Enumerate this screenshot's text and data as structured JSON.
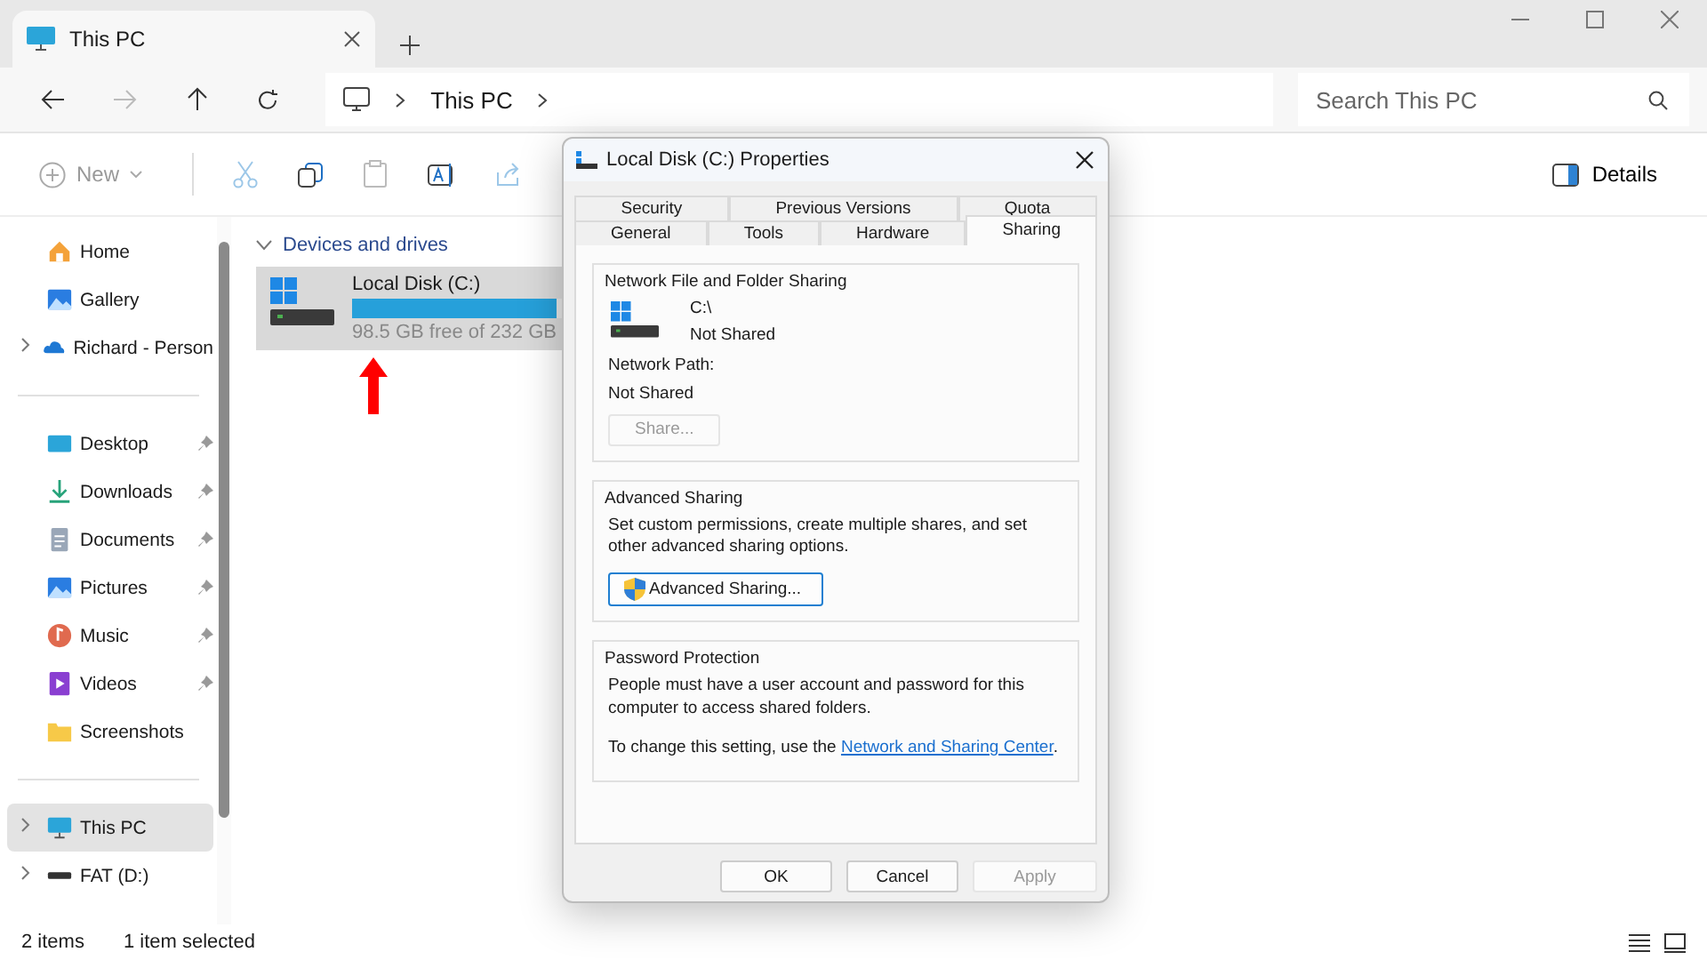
{
  "window": {
    "tab_title": "This PC"
  },
  "nav": {
    "address": [
      "This PC"
    ],
    "search": {
      "placeholder": "Search This PC"
    }
  },
  "command_bar": {
    "new_label": "New",
    "details_label": "Details"
  },
  "sidebar": {
    "groups": [
      [
        {
          "label": "Home",
          "kind": "home",
          "expandable": false,
          "pinned": false,
          "selected": false
        },
        {
          "label": "Gallery",
          "kind": "gallery",
          "expandable": false,
          "pinned": false,
          "selected": false
        },
        {
          "label": "Richard - Person",
          "kind": "cloud",
          "expandable": true,
          "pinned": false,
          "selected": false
        }
      ],
      [
        {
          "label": "Desktop",
          "kind": "desktop",
          "expandable": false,
          "pinned": true,
          "selected": false
        },
        {
          "label": "Downloads",
          "kind": "download",
          "expandable": false,
          "pinned": true,
          "selected": false
        },
        {
          "label": "Documents",
          "kind": "document",
          "expandable": false,
          "pinned": true,
          "selected": false
        },
        {
          "label": "Pictures",
          "kind": "gallery",
          "expandable": false,
          "pinned": true,
          "selected": false
        },
        {
          "label": "Music",
          "kind": "music",
          "expandable": false,
          "pinned": true,
          "selected": false
        },
        {
          "label": "Videos",
          "kind": "video",
          "expandable": false,
          "pinned": true,
          "selected": false
        },
        {
          "label": "Screenshots",
          "kind": "folder",
          "expandable": false,
          "pinned": false,
          "selected": false
        }
      ],
      [
        {
          "label": "This PC",
          "kind": "pc",
          "expandable": true,
          "pinned": false,
          "selected": true
        },
        {
          "label": "FAT (D:)",
          "kind": "drive",
          "expandable": true,
          "pinned": false,
          "selected": false
        }
      ]
    ]
  },
  "content": {
    "section": {
      "title": "Devices and drives",
      "expanded": true
    },
    "drives": [
      {
        "name": "Local Disk (C:)",
        "level": 0.575,
        "free": "98.5 GB free of 232 GB",
        "selected": true
      }
    ]
  },
  "status_bar": {
    "item_count": "2 items",
    "selection": "1 item selected"
  },
  "dialog": {
    "title": "Local Disk (C:) Properties",
    "tab_rows": [
      [
        {
          "label": "Security",
          "selected": false
        },
        {
          "label": "Previous Versions",
          "selected": false
        },
        {
          "label": "Quota",
          "selected": false
        }
      ],
      [
        {
          "label": "General",
          "selected": false
        },
        {
          "label": "Tools",
          "selected": false
        },
        {
          "label": "Hardware",
          "selected": false
        },
        {
          "label": "Sharing",
          "selected": true
        }
      ]
    ],
    "network_sharing": {
      "title": "Network File and Folder Sharing",
      "path": "C:\\",
      "status": "Not Shared",
      "network_path_label": "Network Path:",
      "network_path": "Not Shared",
      "share_button": {
        "label": "Share...",
        "disabled": true
      }
    },
    "advanced_sharing": {
      "title": "Advanced Sharing",
      "description": "Set custom permissions, create multiple shares, and set other advanced sharing options.",
      "button": "Advanced Sharing..."
    },
    "password_protection": {
      "title": "Password Protection",
      "description": "People must have a user account and password for this computer to access shared folders.",
      "link_prefix": "To change this setting, use the",
      "link": "Network and Sharing Center",
      "link_suffix": "."
    },
    "buttons": [
      {
        "label": "OK",
        "disabled": false
      },
      {
        "label": "Cancel",
        "disabled": false
      },
      {
        "label": "Apply",
        "disabled": true
      }
    ]
  }
}
